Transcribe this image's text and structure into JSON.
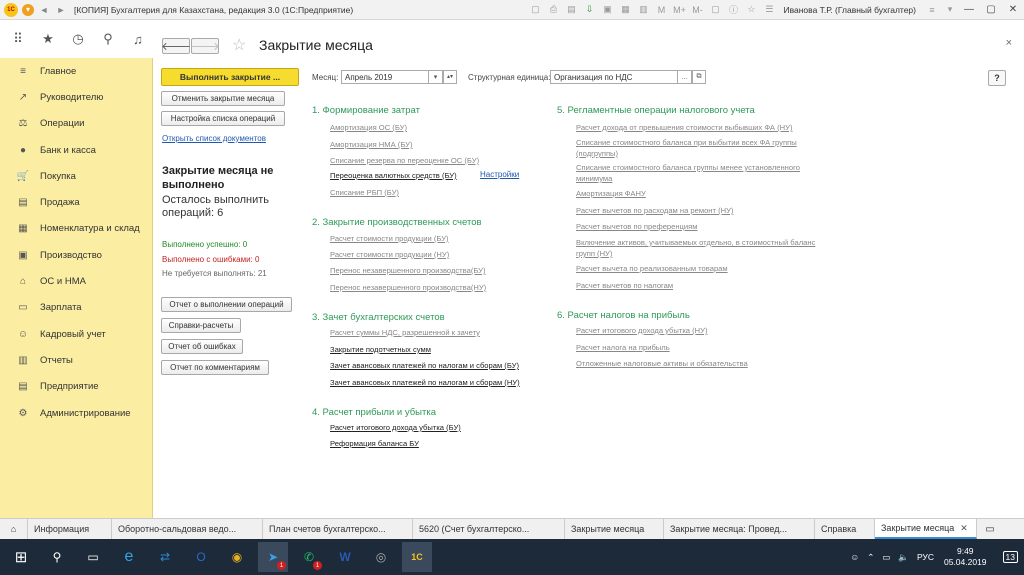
{
  "titlebar": {
    "logo": "1С",
    "app_title": "[КОПИЯ] Бухгалтерия для Казахстана, редакция 3.0  (1С:Предприятие)",
    "user": "Иванова Т.Р. (Главный бухгалтер)",
    "icons": [
      "home-icon",
      "print-icon",
      "save-icon",
      "history-icon",
      "calendar-icon",
      "calculator-icon",
      "memory-icon",
      "zoom-icon",
      "info-icon",
      "favorite-icon",
      "bell-icon"
    ],
    "memory_labels": [
      "M",
      "M+",
      "M-"
    ]
  },
  "toolbar": {
    "icons": [
      "apps-grid-icon",
      "star-icon",
      "history-icon",
      "search-icon",
      "bell-icon"
    ]
  },
  "sidebar": {
    "items": [
      {
        "label": "Главное",
        "icon": "≡"
      },
      {
        "label": "Руководителю",
        "icon": "↗"
      },
      {
        "label": "Операции",
        "icon": "⚖"
      },
      {
        "label": "Банк и касса",
        "icon": "●"
      },
      {
        "label": "Покупка",
        "icon": "🛒"
      },
      {
        "label": "Продажа",
        "icon": "▤"
      },
      {
        "label": "Номенклатура и склад",
        "icon": "▦"
      },
      {
        "label": "Производство",
        "icon": "▣"
      },
      {
        "label": "ОС и НМА",
        "icon": "⌂"
      },
      {
        "label": "Зарплата",
        "icon": "▭"
      },
      {
        "label": "Кадровый учет",
        "icon": "☺"
      },
      {
        "label": "Отчеты",
        "icon": "▥"
      },
      {
        "label": "Предприятие",
        "icon": "▤"
      },
      {
        "label": "Администрирование",
        "icon": "⚙"
      }
    ]
  },
  "main": {
    "back": "🡐",
    "forward": "🡒",
    "title": "Закрытие месяца",
    "close": "×",
    "run_button": "Выполнить закрытие ...",
    "cancel_button": "Отменить закрытие месяца",
    "settings_button": "Настройка списка операций",
    "open_docs_link": "Открыть список документов",
    "status_title": "Закрытие месяца не выполнено",
    "remain": "Осталось выполнить операций: 6",
    "stat_ok": "Выполнено успешно: 0",
    "stat_err": "Выполнено с ошибками: 0",
    "stat_skip": "Не требуется выполнять: 21",
    "report_button": "Отчет о выполнении операций",
    "calc_button": "Справки-расчеты",
    "errors_button": "Отчет об ошибках",
    "comments_button": "Отчет по комментариям",
    "month_label": "Месяц:",
    "month_value": "Апрель 2019",
    "unit_label": "Структурная единица:",
    "unit_value": "Организация по НДС",
    "help": "?",
    "colors": {
      "section": "#2d9a57",
      "run_button": "#f6dc2e",
      "ok": "#1f8a1f",
      "err": "#c62020",
      "link": "#2058b0"
    }
  },
  "sections": {
    "s1": {
      "title": "1. Формирование затрат",
      "ops": [
        "Амортизация ОС (БУ)",
        "Амортизация НМА (БУ)",
        "Списание резерва по переоценке ОС (БУ)",
        "Переоценка валютных средств (БУ)",
        "Списание РБП (БУ)"
      ],
      "settings_link": "Настройки"
    },
    "s2": {
      "title": "2. Закрытие производственных счетов",
      "ops": [
        "Расчет стоимости продукции (БУ)",
        "Расчет стоимости продукции (НУ)",
        "Перенос незавершенного производства(БУ)",
        "Перенос незавершенного производства(НУ)"
      ]
    },
    "s3": {
      "title": "3. Зачет бухгалтерских счетов",
      "ops": [
        "Расчет суммы НДС, разрешенной к зачету",
        "Закрытие подотчетных сумм",
        "Зачет авансовых платежей по налогам и сборам (БУ)",
        "Зачет авансовых платежей по налогам и сборам (НУ)"
      ]
    },
    "s4": {
      "title": "4. Расчет прибыли и убытка",
      "ops": [
        "Расчет итогового дохода убытка (БУ)",
        "Реформация баланса БУ"
      ]
    },
    "s5": {
      "title": "5. Регламентные операции налогового учета",
      "ops": [
        "Расчет дохода от превышения стоимости выбывших ФА (НУ)",
        "Списание стоимостного баланса при выбытии всех ФА группы (подгруппы)",
        "Списание стоимостного баланса группы менее установленного минимума",
        "Амортизация ФАНУ",
        "Расчет вычетов по расходам на ремонт (НУ)",
        "Расчет вычетов по преференциям",
        "Включение активов, учитываемых отдельно, в стоимостный баланс групп (НУ)",
        "Расчет вычета по реализованным товарам",
        "Расчет вычетов по налогам"
      ]
    },
    "s6": {
      "title": "6. Расчет налогов на прибыль",
      "ops": [
        "Расчет итогового дохода убытка (НУ)",
        "Расчет налога на прибыль",
        "Отложенные налоговые активы и обязательства"
      ]
    }
  },
  "tabs": [
    {
      "label": "⌂"
    },
    {
      "label": "Информация"
    },
    {
      "label": "Оборотно-сальдовая ведо..."
    },
    {
      "label": "План счетов бухгалтерско..."
    },
    {
      "label": "5620 (Счет бухгалтерско..."
    },
    {
      "label": "Закрытие месяца"
    },
    {
      "label": "Закрытие месяца: Провед..."
    },
    {
      "label": "Справка"
    },
    {
      "label": "Закрытие месяца"
    }
  ],
  "taskbar": {
    "time": "9:49",
    "date": "05.04.2019",
    "lang": "РУС",
    "notif_count": "13",
    "badge_count": "1",
    "word_label": "W",
    "onec_label": "1С"
  }
}
